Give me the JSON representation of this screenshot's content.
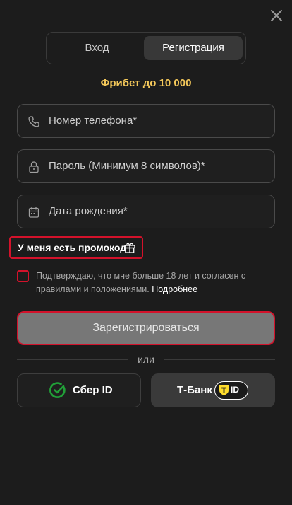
{
  "header": {
    "close_icon": "close-icon"
  },
  "tabs": [
    {
      "label": "Вход",
      "active": false
    },
    {
      "label": "Регистрация",
      "active": true
    }
  ],
  "promo_title": "Фрибет до 10 000",
  "form": {
    "phone": {
      "placeholder": "Номер телефона*",
      "icon": "phone-icon"
    },
    "password": {
      "placeholder": "Пароль (Минимум 8 символов)*",
      "icon": "lock-icon"
    },
    "birthdate": {
      "placeholder": "Дата рождения*",
      "icon": "calendar-icon"
    }
  },
  "promo_code_link": {
    "label": "У меня есть промокод",
    "icon": "gift-icon"
  },
  "consent": {
    "text": "Подтверждаю, что мне больше 18 лет и согласен с правилами и положениями.",
    "more_link": "Подробнее",
    "checked": false
  },
  "submit_label": "Зарегистрироваться",
  "divider_label": "или",
  "social": {
    "sber": {
      "label": "Сбер ID",
      "icon": "sber-logo-icon"
    },
    "tbank": {
      "label": "Т-Банк",
      "badge": "ID",
      "icon": "tbank-shield-icon"
    }
  },
  "colors": {
    "background": "#1c1c1c",
    "accent_gold": "#f4c85a",
    "error_red": "#d3122b",
    "submit_disabled": "#777777",
    "sber_green": "#21a038",
    "tbank_yellow": "#ffdd2d"
  }
}
